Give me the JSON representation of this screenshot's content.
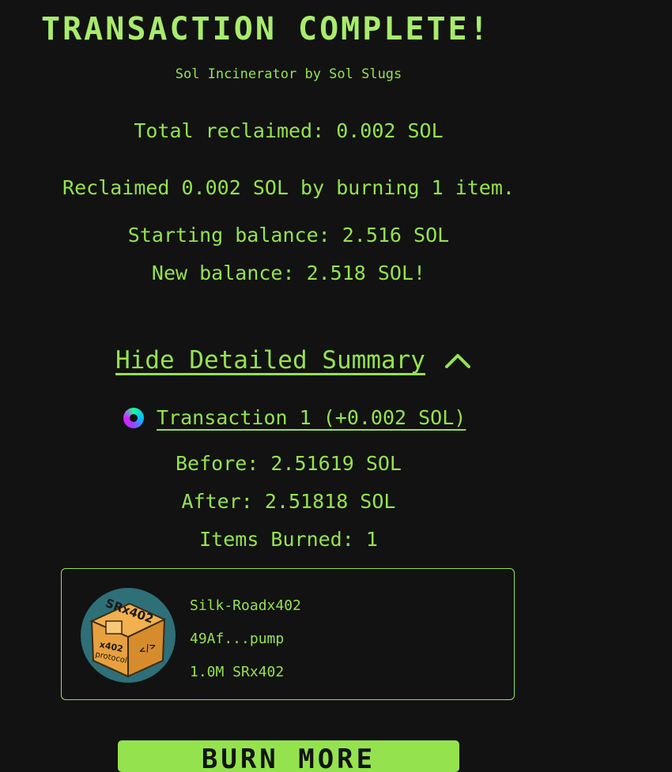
{
  "header": {
    "title": "TRANSACTION COMPLETE!",
    "subtitle": "Sol Incinerator by Sol Slugs"
  },
  "summary": {
    "total": "Total reclaimed: 0.002 SOL",
    "reclaimed": "Reclaimed 0.002 SOL by burning 1 item.",
    "starting_balance": "Starting balance: 2.516 SOL",
    "new_balance": "New balance: 2.518 SOL!"
  },
  "details": {
    "toggle_label": "Hide Detailed Summary",
    "toggle_icon": "chevron-up-icon",
    "transaction_label": "Transaction 1 (+0.002 SOL)",
    "before": "Before: 2.51619 SOL",
    "after": "After: 2.51818 SOL",
    "items_burned": "Items Burned: 1"
  },
  "token": {
    "name": "Silk-Roadx402",
    "address": "49Af...pump",
    "amount": "1.0M SRx402",
    "image_text_top": "SRx402",
    "image_text_side": "x402",
    "image_text_side2": "protocol",
    "image_text_code": "</>"
  },
  "bottom_button": {
    "label": "BURN MORE"
  },
  "colors": {
    "background": "#121212",
    "accent": "#94e34e"
  }
}
